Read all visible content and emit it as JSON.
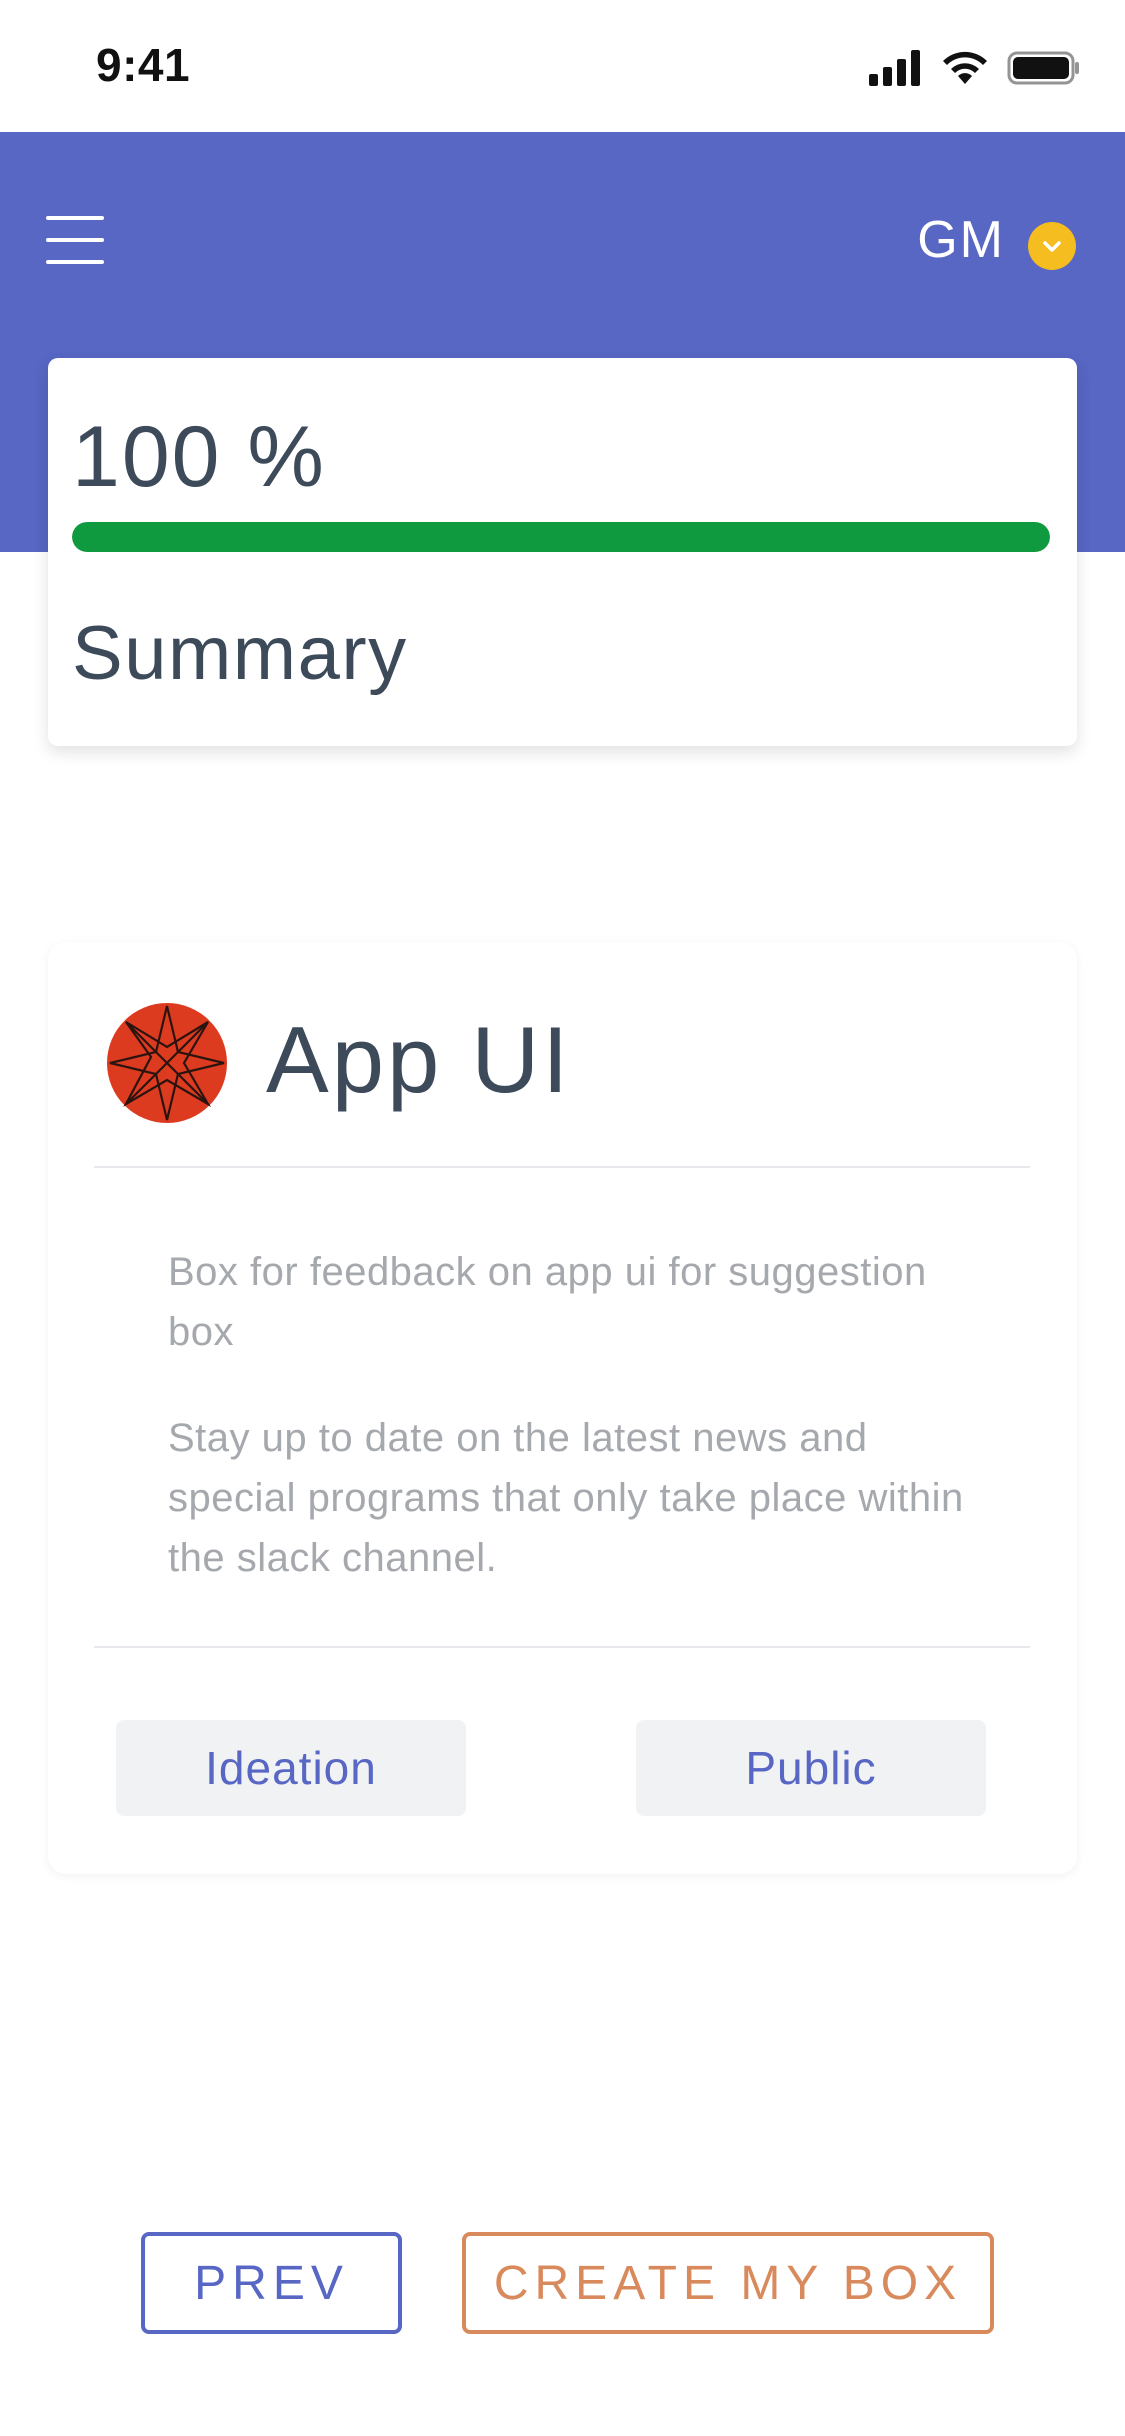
{
  "status_bar": {
    "time": "9:41",
    "icons": [
      "signal-icon",
      "wifi-icon",
      "battery-icon"
    ]
  },
  "header": {
    "menu_icon": "hamburger-menu-icon",
    "user_initials": "GM",
    "dropdown_icon": "chevron-down-icon",
    "background_color": "#5866c4",
    "dropdown_color": "#f5bd1f"
  },
  "progress": {
    "percent_label": "100 %",
    "value": 1.0,
    "fill_color": "#0f9a3f",
    "summary_label": "Summary"
  },
  "box": {
    "avatar_icon": "red-starburst-avatar-icon",
    "title": "App UI",
    "description": "Box for feedback on app ui for suggestion box",
    "details": "Stay up to date on the latest news and special programs that only take place within the slack channel.",
    "tags": [
      "Ideation",
      "Public"
    ]
  },
  "actions": {
    "prev_label": "PREV",
    "create_label": "CREATE MY BOX",
    "prev_color": "#5866c4",
    "create_color": "#d98a5c"
  }
}
